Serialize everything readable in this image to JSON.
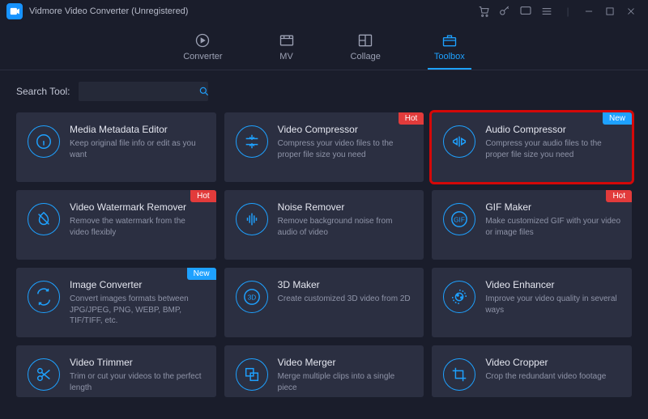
{
  "app": {
    "title": "Vidmore Video Converter (Unregistered)"
  },
  "tabs": [
    {
      "label": "Converter"
    },
    {
      "label": "MV"
    },
    {
      "label": "Collage"
    },
    {
      "label": "Toolbox"
    }
  ],
  "search": {
    "label": "Search Tool:",
    "value": ""
  },
  "badges": {
    "hot": "Hot",
    "new": "New"
  },
  "tools": [
    {
      "title": "Media Metadata Editor",
      "desc": "Keep original file info or edit as you want"
    },
    {
      "title": "Video Compressor",
      "desc": "Compress your video files to the proper file size you need",
      "badge": "hot"
    },
    {
      "title": "Audio Compressor",
      "desc": "Compress your audio files to the proper file size you need",
      "badge": "new",
      "highlight": true
    },
    {
      "title": "Video Watermark Remover",
      "desc": "Remove the watermark from the video flexibly",
      "badge": "hot"
    },
    {
      "title": "Noise Remover",
      "desc": "Remove background noise from audio of video"
    },
    {
      "title": "GIF Maker",
      "desc": "Make customized GIF with your video or image files",
      "badge": "hot"
    },
    {
      "title": "Image Converter",
      "desc": "Convert images formats between JPG/JPEG, PNG, WEBP, BMP, TIF/TIFF, etc.",
      "badge": "new"
    },
    {
      "title": "3D Maker",
      "desc": "Create customized 3D video from 2D"
    },
    {
      "title": "Video Enhancer",
      "desc": "Improve your video quality in several ways"
    },
    {
      "title": "Video Trimmer",
      "desc": "Trim or cut your videos to the perfect length"
    },
    {
      "title": "Video Merger",
      "desc": "Merge multiple clips into a single piece"
    },
    {
      "title": "Video Cropper",
      "desc": "Crop the redundant video footage"
    }
  ]
}
